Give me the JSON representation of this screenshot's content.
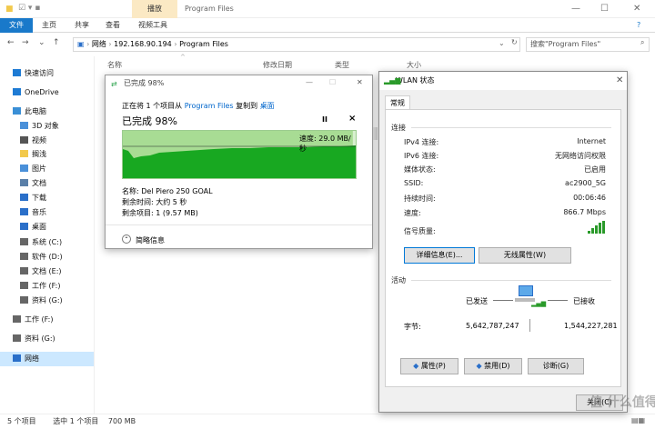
{
  "titlebar": {
    "ctx_tab": "播放",
    "title": "Program Files"
  },
  "ribbon": {
    "file": "文件",
    "tabs": [
      "主页",
      "共享",
      "查看"
    ],
    "ctx_tool": "视频工具"
  },
  "nav": {
    "path": [
      "网络",
      "192.168.90.194",
      "Program Files"
    ],
    "search_placeholder": "搜索\"Program Files\""
  },
  "columns": [
    "名称",
    "修改日期",
    "类型",
    "大小"
  ],
  "sidebar": [
    {
      "label": "快速访问",
      "icon": "star-icon",
      "color": "#1e7bd4"
    },
    {
      "label": "OneDrive",
      "icon": "cloud-icon",
      "color": "#1e7bd4"
    },
    {
      "label": "此电脑",
      "icon": "pc-icon",
      "color": "#3a8fd6"
    },
    {
      "label": "3D 对象",
      "icon": "cube-icon",
      "color": "#4a90d9"
    },
    {
      "label": "视频",
      "icon": "video-icon",
      "color": "#555"
    },
    {
      "label": "搁浅",
      "icon": "folder-icon",
      "color": "#f2c94c"
    },
    {
      "label": "图片",
      "icon": "picture-icon",
      "color": "#4a90d9"
    },
    {
      "label": "文档",
      "icon": "document-icon",
      "color": "#5a7fa8"
    },
    {
      "label": "下载",
      "icon": "download-icon",
      "color": "#2a6fc9"
    },
    {
      "label": "音乐",
      "icon": "music-icon",
      "color": "#2a6fc9"
    },
    {
      "label": "桌面",
      "icon": "desktop-icon",
      "color": "#2a6fc9"
    },
    {
      "label": "系统 (C:)",
      "icon": "drive-icon",
      "color": "#666"
    },
    {
      "label": "软件 (D:)",
      "icon": "drive-icon",
      "color": "#666"
    },
    {
      "label": "文档 (E:)",
      "icon": "drive-icon",
      "color": "#666"
    },
    {
      "label": "工作 (F:)",
      "icon": "drive-icon",
      "color": "#666"
    },
    {
      "label": "资料 (G:)",
      "icon": "drive-icon",
      "color": "#666"
    },
    {
      "label": "工作 (F:)",
      "icon": "drive-icon",
      "color": "#666"
    },
    {
      "label": "资料 (G:)",
      "icon": "drive-icon",
      "color": "#666"
    },
    {
      "label": "网络",
      "icon": "network-icon",
      "color": "#2a6fc9"
    }
  ],
  "status": {
    "items": "5 个项目",
    "selected": "选中 1 个项目",
    "size": "700 MB"
  },
  "copy": {
    "title": "已完成 98%",
    "line1_pre": "正在将 1 个项目从",
    "line1_src": "Program Files",
    "line1_mid": "复制到",
    "line1_dst": "桌面",
    "progress": "已完成 98%",
    "pause": "II",
    "close": "×",
    "speed": "速度: 29.0 MB/秒",
    "progress_pct": 98,
    "name": "名称: Del Piero 250 GOAL",
    "remaining_time": "剩余时间: 大约 5 秒",
    "remaining_items": "剩余项目: 1 (9.57 MB)",
    "details": "简略信息"
  },
  "wlan": {
    "title": "WLAN 状态",
    "tab": "常规",
    "connection_header": "连接",
    "rows": [
      {
        "label": "IPv4 连接:",
        "value": "Internet"
      },
      {
        "label": "IPv6 连接:",
        "value": "无网络访问权限"
      },
      {
        "label": "媒体状态:",
        "value": "已启用"
      },
      {
        "label": "SSID:",
        "value": "ac2900_5G"
      },
      {
        "label": "持续时间:",
        "value": "00:06:46"
      },
      {
        "label": "速度:",
        "value": "866.7 Mbps"
      }
    ],
    "signal_label": "信号质量:",
    "details_btn": "详细信息(E)...",
    "wireless_btn": "无线属性(W)",
    "activity_header": "活动",
    "sent_label": "已发送",
    "recv_label": "已接收",
    "bytes_label": "字节:",
    "bytes_sent": "5,642,787,247",
    "bytes_recv": "1,544,227,281",
    "props_btn": "属性(P)",
    "disable_btn": "禁用(D)",
    "diag_btn": "诊断(G)",
    "close_btn": "关闭(C)"
  },
  "watermark": "值 什么值得买"
}
